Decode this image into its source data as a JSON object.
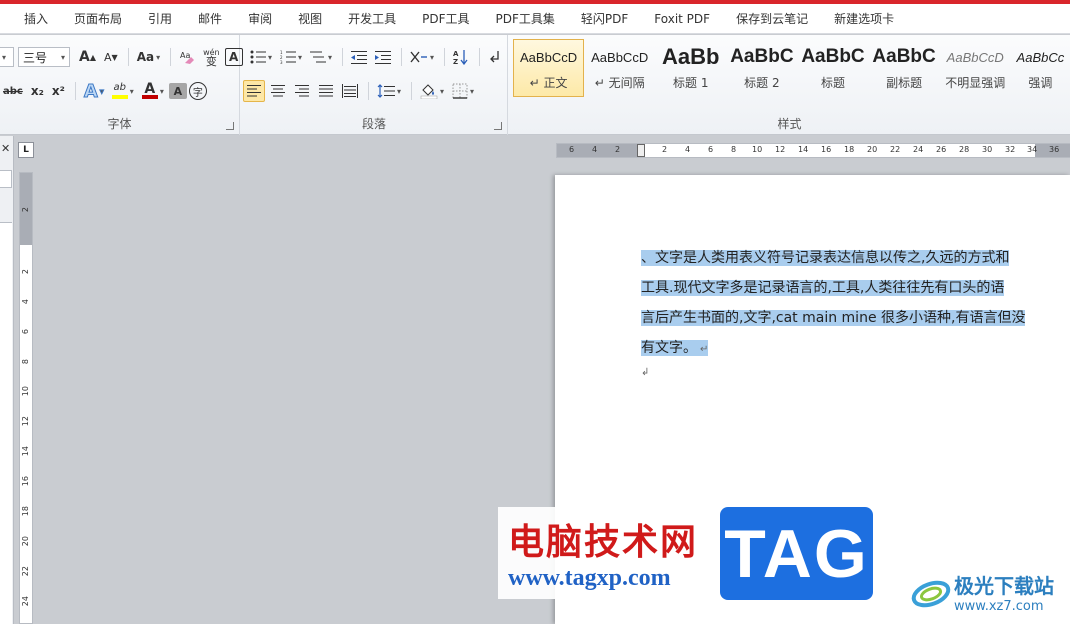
{
  "menu": {
    "tabs": [
      "插入",
      "页面布局",
      "引用",
      "邮件",
      "审阅",
      "视图",
      "开发工具",
      "PDF工具",
      "PDF工具集",
      "轻闪PDF",
      "Foxit PDF",
      "保存到云笔记",
      "新建选项卡"
    ]
  },
  "font_group": {
    "label": "字体",
    "font_size": "三号",
    "grow": "A",
    "shrink": "A",
    "change_case": "Aa",
    "phonetic_top": "wén",
    "phonetic_bottom": "变",
    "border_char": "A",
    "strikethrough": "abc",
    "subscript": "x₂",
    "superscript": "x²",
    "text_effect": "A",
    "highlight": "ab",
    "font_color": "A",
    "char_shading": "A",
    "enclose": "字"
  },
  "paragraph_group": {
    "label": "段落",
    "sort": "A↓Z"
  },
  "styles_group": {
    "label": "样式",
    "items": [
      {
        "sample": "AaBbCcD",
        "name": "↵ 正文"
      },
      {
        "sample": "AaBbCcD",
        "name": "↵ 无间隔"
      },
      {
        "sample": "AaBb",
        "name": "标题 1"
      },
      {
        "sample": "AaBbC",
        "name": "标题 2"
      },
      {
        "sample": "AaBbC",
        "name": "标题"
      },
      {
        "sample": "AaBbC",
        "name": "副标题"
      },
      {
        "sample": "AaBbCcD",
        "name": "不明显强调"
      },
      {
        "sample": "AaBbCc",
        "name": "强调"
      }
    ]
  },
  "left_pane": {
    "close": "✕"
  },
  "ruler_corner": "L",
  "hruler_ticks": [
    "6",
    "4",
    "2",
    "2",
    "4",
    "6",
    "8",
    "10",
    "12",
    "14",
    "16",
    "18",
    "20",
    "22",
    "24",
    "26",
    "28",
    "30",
    "32",
    "34",
    "36"
  ],
  "vruler_ticks": [
    "2",
    "2",
    "4",
    "6",
    "8",
    "10",
    "12",
    "14",
    "16",
    "18",
    "20",
    "22",
    "24"
  ],
  "document": {
    "lines": [
      "、文字是人类用表义符号记录表达信息以传之,久远的方式和",
      "工具.现代文字多是记录语言的,工具,人类往往先有口头的语",
      "言后产生书面的,文字,cat  main mine 很多小语种,有语言但没",
      "有文字。"
    ],
    "paragraph_mark": "↵",
    "empty_paragraph_mark": "↲"
  },
  "watermark": {
    "cn_title": "电脑技术网",
    "url": "www.tagxp.com",
    "tag": "TAG",
    "right_cn": "极光下载站",
    "right_url": "www.xz7.com"
  }
}
